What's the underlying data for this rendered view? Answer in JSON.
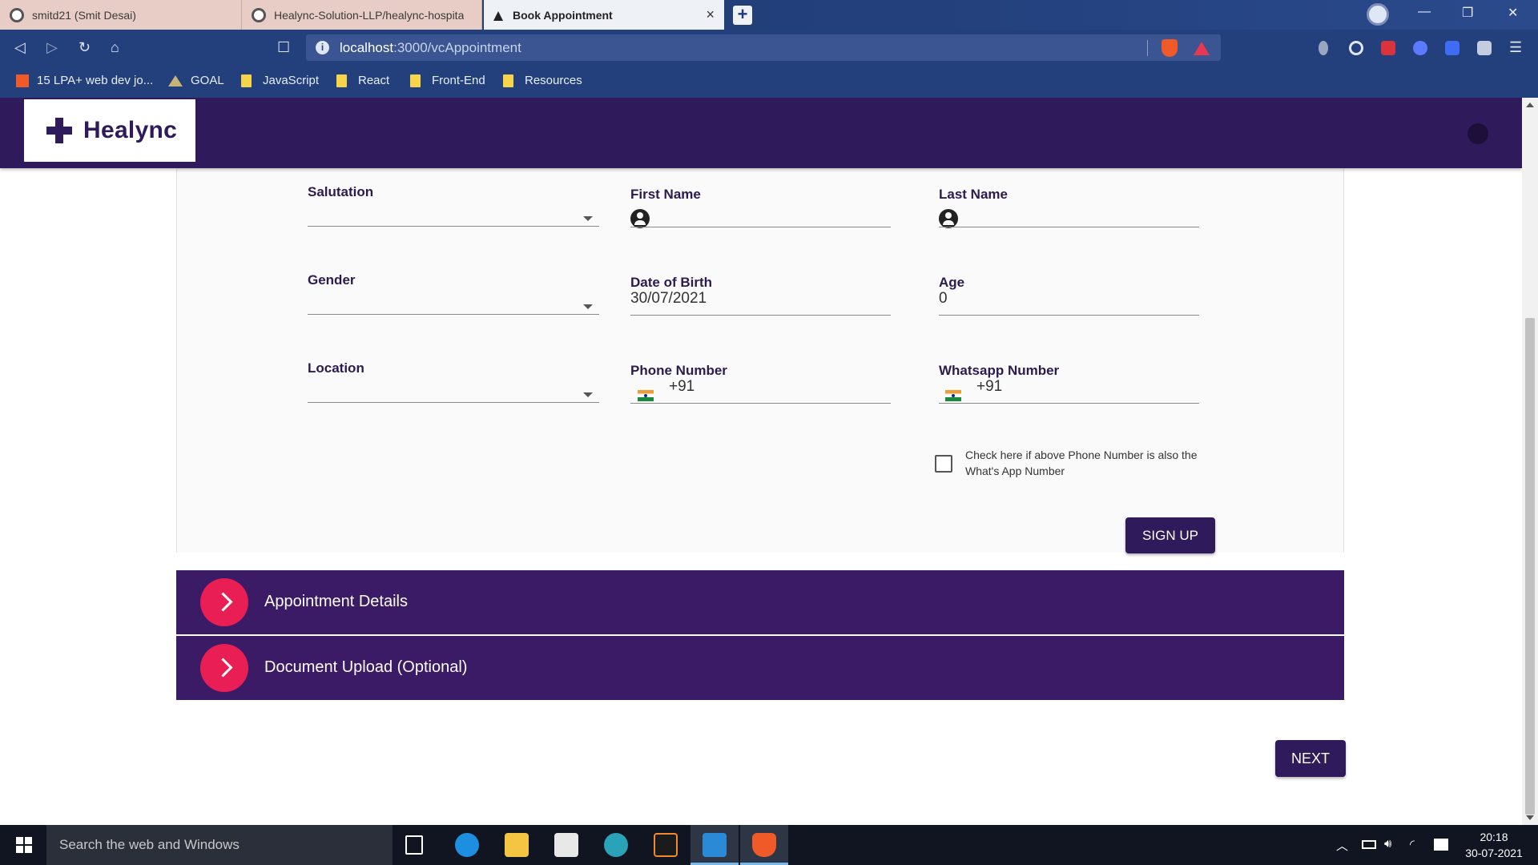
{
  "browser": {
    "tabs": [
      {
        "title": "smitd21 (Smit Desai)"
      },
      {
        "title": "Healync-Solution-LLP/healync-hospita"
      },
      {
        "title": "Book Appointment"
      }
    ],
    "tab_close": "×",
    "new_tab": "+",
    "window_controls": {
      "minimize": "—",
      "restore": "❐",
      "close": "✕"
    },
    "url_host": "localhost",
    "url_path": ":3000/vcAppointment",
    "nav_icons": {
      "back": "◁",
      "forward": "▷",
      "reload": "↻",
      "home": "⌂",
      "bookmark": "☐",
      "menu": "☰"
    },
    "bookmarks": [
      {
        "label": "15 LPA+ web dev jo...",
        "icon": "bookmark-ribbon-icon"
      },
      {
        "label": "GOAL",
        "icon": "mountain-icon"
      },
      {
        "label": "JavaScript",
        "icon": "folder-icon"
      },
      {
        "label": "React",
        "icon": "folder-icon"
      },
      {
        "label": "Front-End",
        "icon": "folder-icon"
      },
      {
        "label": "Resources",
        "icon": "folder-icon"
      }
    ]
  },
  "app": {
    "brand": "Healync"
  },
  "form": {
    "salutation": {
      "label": "Salutation",
      "value": ""
    },
    "first_name": {
      "label": "First Name",
      "value": ""
    },
    "last_name": {
      "label": "Last Name",
      "value": ""
    },
    "gender": {
      "label": "Gender",
      "value": ""
    },
    "dob": {
      "label": "Date of Birth",
      "value": "30/07/2021"
    },
    "age": {
      "label": "Age",
      "value": "0"
    },
    "location": {
      "label": "Location",
      "value": ""
    },
    "phone": {
      "label": "Phone Number",
      "value": "+91"
    },
    "whatsapp": {
      "label": "Whatsapp Number",
      "value": "+91"
    },
    "same_number_checkbox": {
      "label": "Check here if above Phone Number is also the What's App Number",
      "checked": false
    },
    "signup_button": "SIGN UP"
  },
  "accordions": [
    {
      "title": "Appointment Details"
    },
    {
      "title": "Document Upload (Optional)"
    }
  ],
  "next_button": "NEXT",
  "taskbar": {
    "search_placeholder": "Search the web and Windows",
    "time": "20:18",
    "date": "30-07-2021"
  },
  "colors": {
    "brand_purple": "#2f1a5c",
    "accordion_purple": "#3b1a66",
    "accent_pink": "#e91e55"
  }
}
